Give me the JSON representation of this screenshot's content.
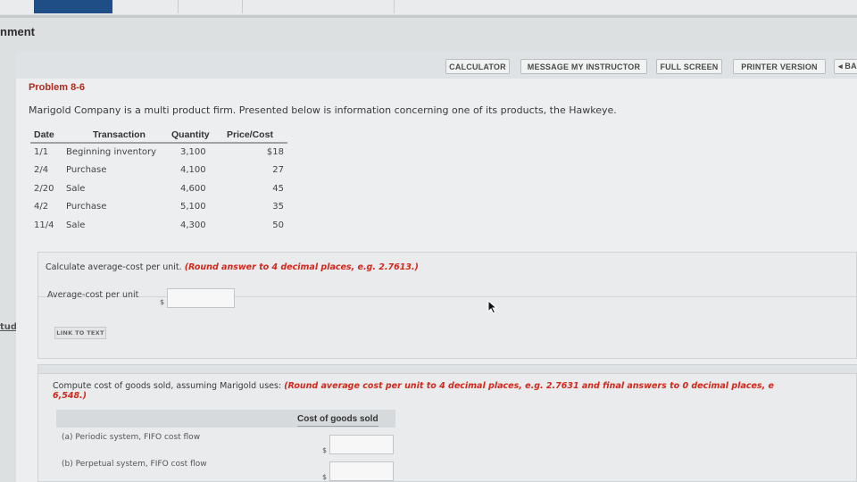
{
  "page": {
    "assignment_title": "nment",
    "study_link": "tudy"
  },
  "toolbar": {
    "calculator": "CALCULATOR",
    "message_instructor": "MESSAGE MY INSTRUCTOR",
    "full_screen": "FULL SCREEN",
    "printer_version": "PRINTER VERSION",
    "back": "◂ BA"
  },
  "problem": {
    "title": "Problem 8-6",
    "intro": "Marigold Company is a multi product firm. Presented below is information concerning one of its products, the Hawkeye."
  },
  "table": {
    "headers": [
      "Date",
      "Transaction",
      "Quantity",
      "Price/Cost"
    ],
    "rows": [
      {
        "date": "1/1",
        "transaction": "Beginning inventory",
        "quantity": "3,100",
        "price": "$18"
      },
      {
        "date": "2/4",
        "transaction": "Purchase",
        "quantity": "4,100",
        "price": "27"
      },
      {
        "date": "2/20",
        "transaction": "Sale",
        "quantity": "4,600",
        "price": "45"
      },
      {
        "date": "4/2",
        "transaction": "Purchase",
        "quantity": "5,100",
        "price": "35"
      },
      {
        "date": "11/4",
        "transaction": "Sale",
        "quantity": "4,300",
        "price": "50"
      }
    ]
  },
  "part1": {
    "question": "Calculate average-cost per unit.",
    "instruction": "(Round answer to 4 decimal places, e.g. 2.7613.)",
    "field_label": "Average-cost per unit",
    "currency": "$",
    "value": ""
  },
  "link_to_text": "LINK TO TEXT",
  "part2": {
    "question": "Compute cost of goods sold, assuming Marigold uses:",
    "instruction_line1": "(Round average cost per unit to 4 decimal places, e.g. 2.7631 and final answers to 0 decimal places, e",
    "instruction_line2": "6,548.)",
    "column_header": "Cost of goods sold",
    "rows": [
      {
        "label": "(a)  Periodic system, FIFO cost flow",
        "currency": "$",
        "value": ""
      },
      {
        "label": "(b)  Perpetual system, FIFO cost flow",
        "currency": "$",
        "value": ""
      }
    ]
  }
}
